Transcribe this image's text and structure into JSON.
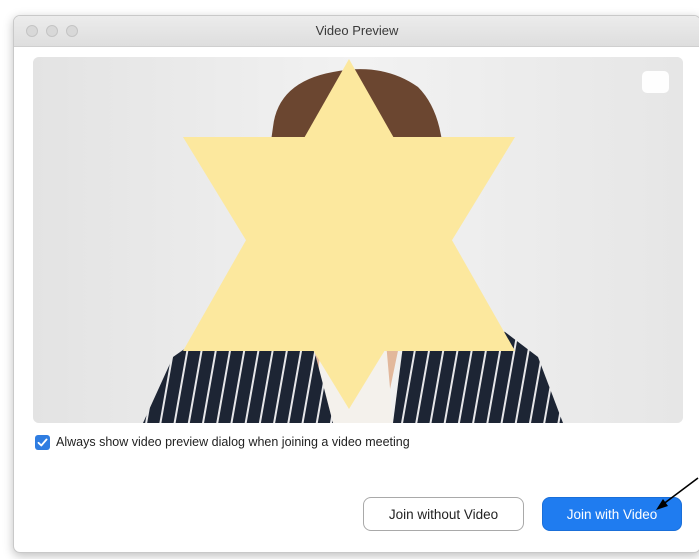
{
  "window": {
    "title": "Video Preview"
  },
  "preview": {
    "checkbox_label": "Always show video preview dialog when joining a video meeting",
    "checkbox_checked": true
  },
  "buttons": {
    "join_without_video": "Join without Video",
    "join_with_video": "Join with Video"
  },
  "colors": {
    "accent": "#1f7cf0",
    "censor_star": "#fce89e"
  },
  "icons": {
    "check": "checkmark-icon",
    "pip": "picture-in-picture-icon",
    "arrow": "annotation-arrow-icon"
  }
}
